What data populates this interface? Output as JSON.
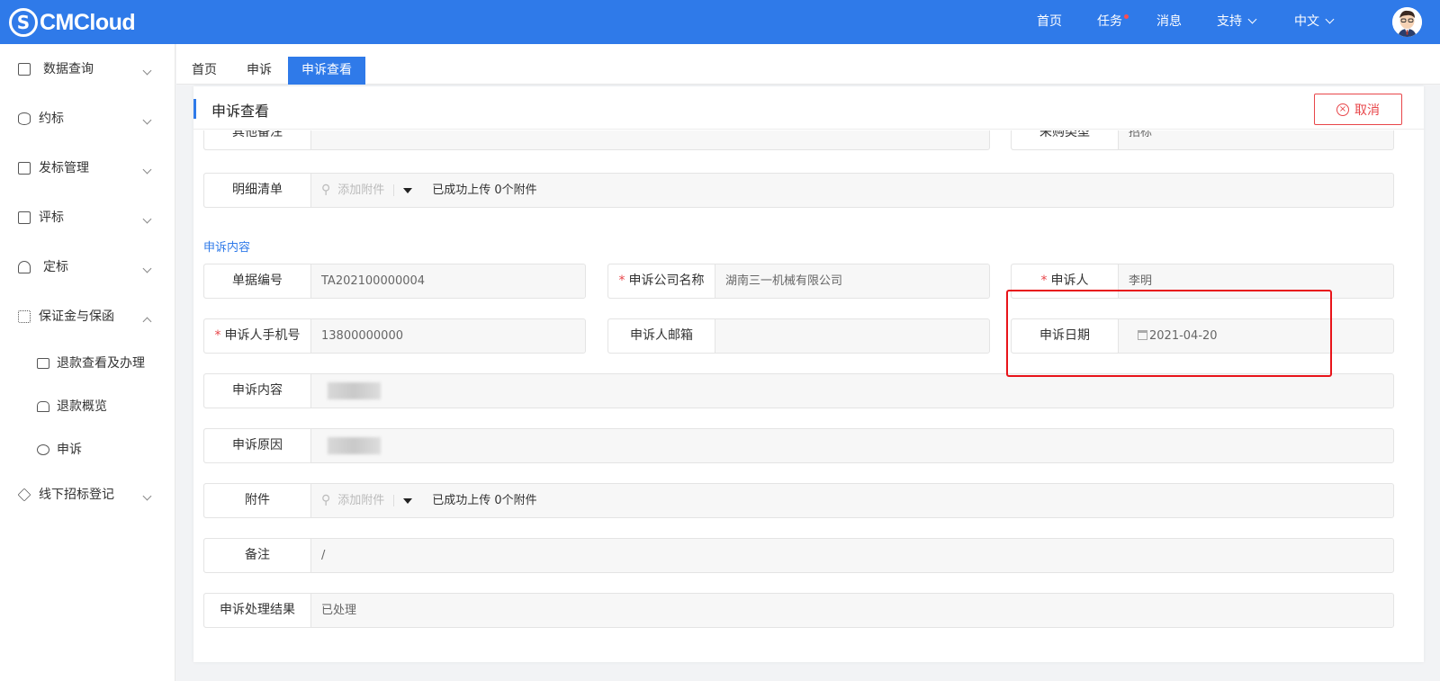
{
  "header": {
    "logo_text": "CMCloud",
    "nav": [
      "首页",
      "任务",
      "消息",
      "支持",
      "中文"
    ]
  },
  "sidebar": {
    "items": [
      {
        "label": "数据查询",
        "icon": "folder-icon"
      },
      {
        "label": "约标",
        "icon": "database-icon"
      },
      {
        "label": "发标管理",
        "icon": "document-icon"
      },
      {
        "label": "评标",
        "icon": "clipboard-icon"
      },
      {
        "label": "定标",
        "icon": "stamp-icon"
      },
      {
        "label": "保证金与保函",
        "icon": "org-chart-icon"
      },
      {
        "label": "线下招标登记",
        "icon": "layers-icon"
      }
    ],
    "sub_items": [
      {
        "label": "退款查看及办理",
        "icon": "id-card-icon"
      },
      {
        "label": "退款概览",
        "icon": "home-icon"
      },
      {
        "label": "申诉",
        "icon": "complaint-icon"
      }
    ]
  },
  "tabs": [
    "首页",
    "申诉",
    "申诉查看"
  ],
  "page": {
    "title": "申诉查看",
    "cancel_label": "取消"
  },
  "fields": {
    "other_notes_label": "其他备注",
    "purchase_type_label": "采购类型",
    "purchase_type_value": "招标",
    "detail_list_label": "明细清单",
    "add_attachment": "添加附件",
    "upload_status": "已成功上传 0个附件",
    "section_title": "申诉内容",
    "doc_no_label": "单据编号",
    "doc_no_value": "TA202100000004",
    "company_label": "申诉公司名称",
    "company_value": "湖南三一机械有限公司",
    "applicant_label": "申诉人",
    "applicant_value": "李明",
    "phone_label": "申诉人手机号",
    "phone_value": "13800000000",
    "email_label": "申诉人邮箱",
    "email_value": "",
    "date_label": "申诉日期",
    "date_value": "2021-04-20",
    "content_label": "申诉内容",
    "reason_label": "申诉原因",
    "attachment_label": "附件",
    "remark_label": "备注",
    "remark_value": "/",
    "result_label": "申诉处理结果",
    "result_value": "已处理"
  },
  "colors": {
    "primary": "#2f7ae9",
    "danger": "#e8464a",
    "highlight_box": "#e8141a"
  }
}
